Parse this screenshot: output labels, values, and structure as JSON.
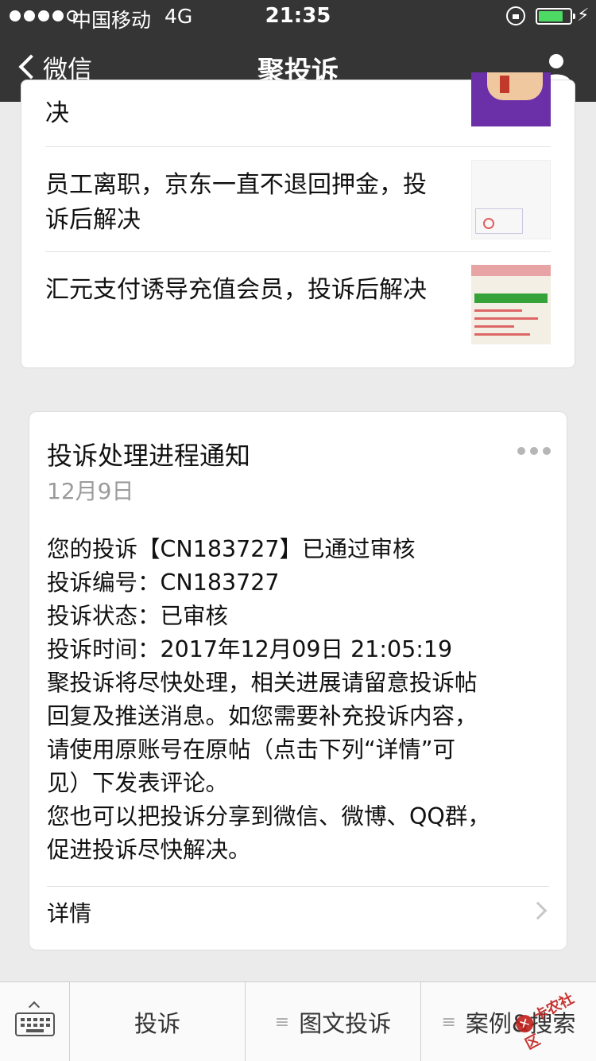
{
  "status_bar": {
    "carrier": "中国移动",
    "network": "4G",
    "time": "21:35",
    "signal_bars": 4,
    "battery_level": 0.8
  },
  "nav": {
    "back_label": "微信",
    "title": "聚投诉",
    "right_icon": "profile-icon"
  },
  "articles": [
    {
      "title": "决",
      "thumb": "hand-image"
    },
    {
      "title": "员工离职，京东一直不退回押金，投诉后解决",
      "thumb": "document-image"
    },
    {
      "title": "汇元支付诱导充值会员，投诉后解决",
      "thumb": "screenshot-image"
    }
  ],
  "notice": {
    "title": "投诉处理进程通知",
    "date": "12月9日",
    "lines": [
      "您的投诉【CN183727】已通过审核",
      "投诉编号：CN183727",
      "投诉状态：已审核",
      "投诉时间：2017年12月09日 21:05:19",
      "聚投诉将尽快处理，相关进展请留意投诉帖",
      "回复及推送消息。如您需要补充投诉内容，",
      "请使用原账号在原帖（点击下列“详情”可",
      "见）下发表评论。",
      "您也可以把投诉分享到微信、微博、QQ群，",
      "促进投诉尽快解决。"
    ],
    "detail_label": "详情"
  },
  "bottom_menu": {
    "items": [
      {
        "label": "投诉",
        "has_submenu": false
      },
      {
        "label": "图文投诉",
        "has_submenu": true
      },
      {
        "label": "案例&搜索",
        "has_submenu": true
      }
    ]
  },
  "watermark": {
    "text": "卡农社区"
  }
}
